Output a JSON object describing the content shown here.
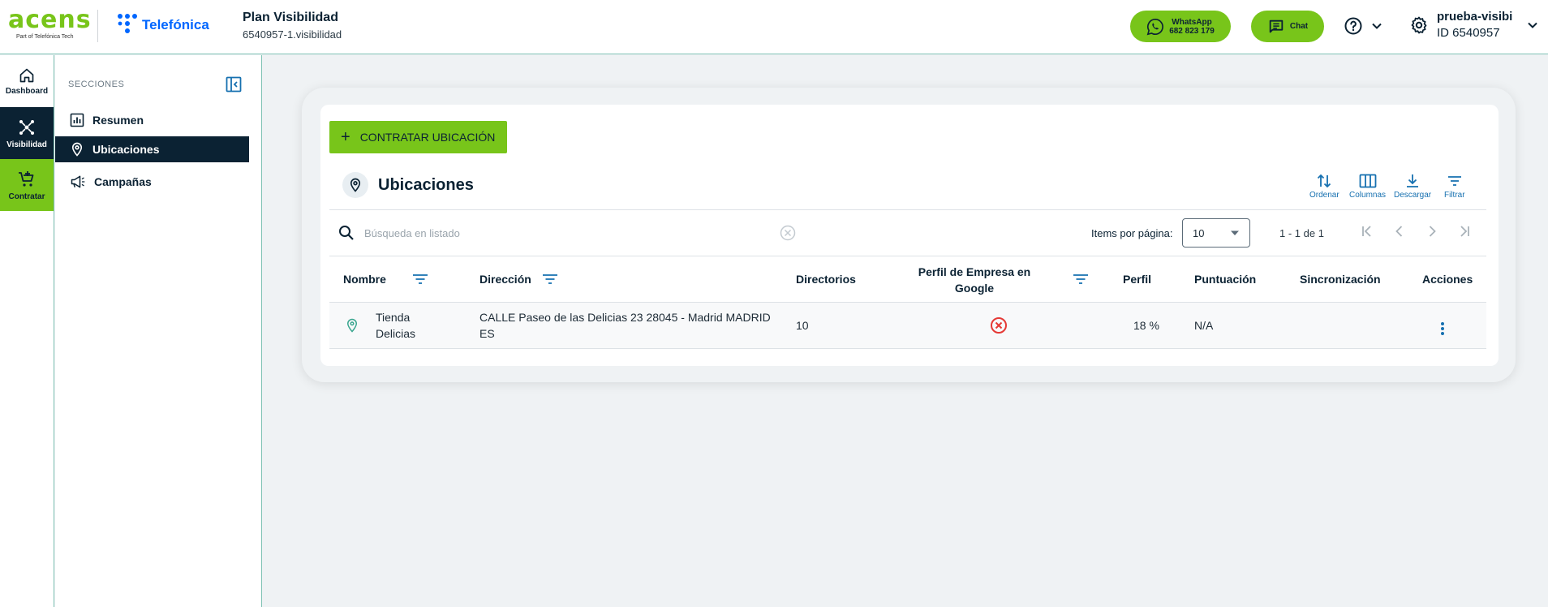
{
  "header": {
    "acens_word": "acens",
    "acens_sub": "Part of Telefónica Tech",
    "telefonica": "Telefónica",
    "plan_title": "Plan Visibilidad",
    "plan_sub": "6540957-1.visibilidad",
    "whatsapp_label": "WhatsApp",
    "whatsapp_number": "682 823 179",
    "chat_label": "Chat",
    "user_name": "prueba-visibi",
    "user_id": "ID 6540957"
  },
  "rail": {
    "dashboard": "Dashboard",
    "visibilidad": "Visibilidad",
    "contratar": "Contratar"
  },
  "sidebar": {
    "heading": "SECCIONES",
    "items": [
      {
        "label": "Resumen",
        "icon": "chart-icon"
      },
      {
        "label": "Ubicaciones",
        "icon": "location-pin-icon"
      },
      {
        "label": "Campañas",
        "icon": "megaphone-icon"
      }
    ]
  },
  "main": {
    "add_button": "CONTRATAR UBICACIÓN",
    "list_title": "Ubicaciones",
    "tools": {
      "sort": "Ordenar",
      "columns": "Columnas",
      "download": "Descargar",
      "filter": "Filtrar"
    },
    "search_placeholder": "Búsqueda en listado",
    "items_per_page_label": "Items por página:",
    "items_per_page_value": "10",
    "range": "1 - 1 de 1",
    "columns": {
      "nombre": "Nombre",
      "direccion": "Dirección",
      "directorios": "Directorios",
      "perfil_google_1": "Perfil de Empresa en",
      "perfil_google_2": "Google",
      "perfil": "Perfil",
      "puntuacion": "Puntuación",
      "sincronizacion": "Sincronización",
      "acciones": "Acciones"
    },
    "rows": [
      {
        "nombre_1": "Tienda",
        "nombre_2": "Delicias",
        "direccion_1": "CALLE Paseo de las Delicias 23 28045 - Madrid MADRID",
        "direccion_2": "ES",
        "directorios": "10",
        "perfil": "18 %",
        "puntuacion": "N/A",
        "sincronizacion": ""
      }
    ]
  },
  "colors": {
    "brand_green": "#78c51a",
    "navy": "#0b2233",
    "link_blue": "#1670b0",
    "error_red": "#e53935",
    "teal": "#3aa68f"
  }
}
